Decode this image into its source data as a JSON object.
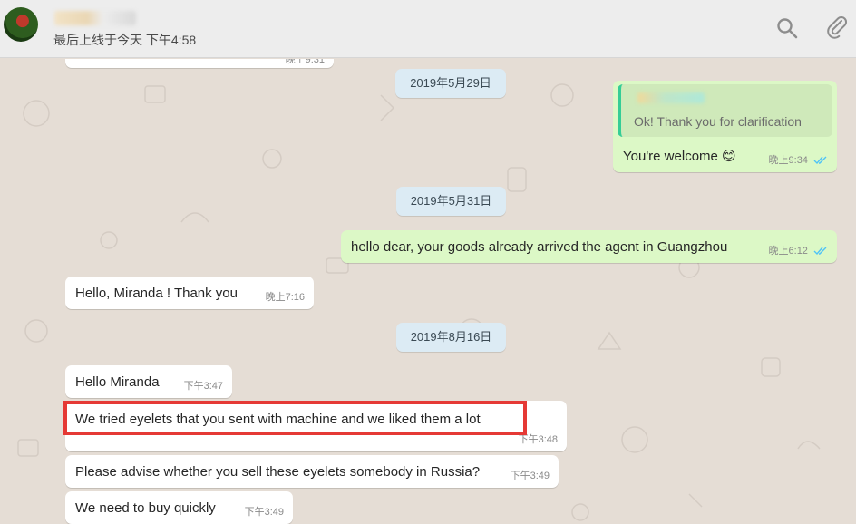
{
  "header": {
    "last_seen": "最后上线于今天 下午4:58",
    "icons": [
      "search-icon",
      "attach-icon"
    ]
  },
  "date_labels": {
    "d1": "2019年5月29日",
    "d2": "2019年5月31日",
    "d3": "2019年8月16日"
  },
  "messages": {
    "m0": {
      "time": "晚上9:31"
    },
    "m1": {
      "quoted_text": "Ok! Thank you for clarification",
      "text": "You're welcome 😊",
      "time": "晚上9:34"
    },
    "m2": {
      "text": "hello dear, your goods already arrived the agent in Guangzhou",
      "time": "晚上6:12"
    },
    "m3": {
      "text": "Hello, Miranda ! Thank you",
      "time": "晚上7:16"
    },
    "m4": {
      "text": "Hello Miranda",
      "time": "下午3:47"
    },
    "m5": {
      "text": "We tried eyelets that you sent with machine and we liked them a lot",
      "time": "下午3:48"
    },
    "m6": {
      "text": "Please advise whether you sell these eyelets somebody in Russia?",
      "time": "下午3:49"
    },
    "m7": {
      "text": "We need to buy quickly",
      "time": "下午3:49"
    }
  },
  "colors": {
    "incoming_bubble": "#ffffff",
    "outgoing_bubble": "#dcf8c6",
    "highlight": "#e53935",
    "read_ticks": "#4fc3f7"
  }
}
